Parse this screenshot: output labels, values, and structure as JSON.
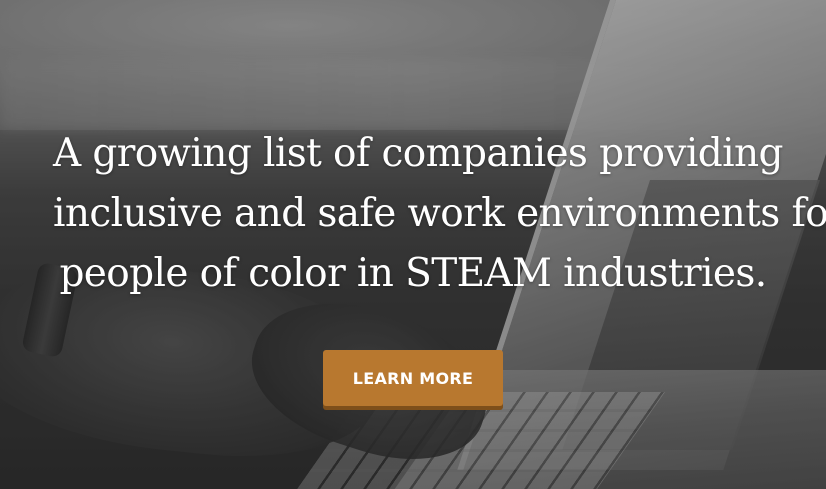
{
  "hero": {
    "headline_lines": [
      "A growing list of companies providing",
      "inclusive and safe work environments for",
      "people of color in STEAM industries."
    ],
    "cta_label": "LEARN MORE",
    "background_image": "laptop-typing-hands-photo",
    "colors": {
      "button_bg": "#b8782f",
      "button_shadow": "#7e4f1a",
      "text": "#ffffff"
    }
  }
}
